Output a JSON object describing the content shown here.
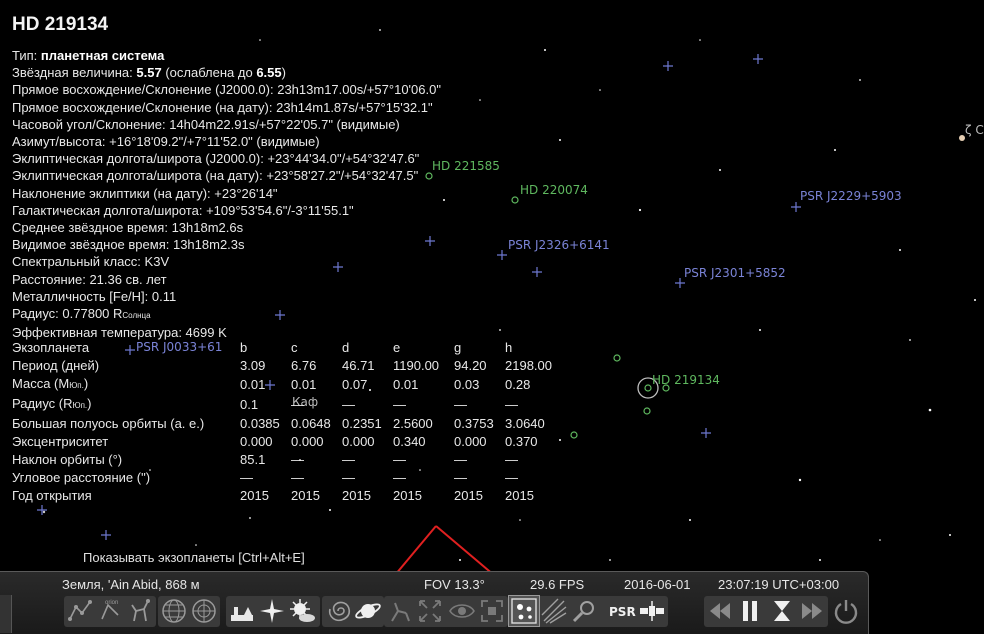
{
  "object": {
    "title": "HD 219134",
    "info_lines": [
      {
        "label": "Тип: ",
        "value": "планетная система",
        "bold": true
      },
      {
        "label": "Звёздная величина: ",
        "value": "5.57",
        "bold": true,
        "suffix": " (ослаблена до ",
        "value2": "6.55",
        "suffix2": ")"
      },
      {
        "label": "Прямое восхождение/Склонение (J2000.0): ",
        "value": "23h13m17.00s/+57°10'06.0\""
      },
      {
        "label": "Прямое восхождение/Склонение (на дату): ",
        "value": "23h14m1.87s/+57°15'32.1\""
      },
      {
        "label": "Часовой угол/Склонение: ",
        "value": "14h04m22.91s/+57°22'05.7\" (видимые)"
      },
      {
        "label": "Азимут/высота: ",
        "value": "+16°18'09.2\"/+7°11'52.0\" (видимые)"
      },
      {
        "label": "Эклиптическая долгота/широта (J2000.0): ",
        "value": "+23°44'34.0\"/+54°32'47.6\""
      },
      {
        "label": "Эклиптическая долгота/широта (на дату): ",
        "value": "+23°58'27.2\"/+54°32'47.5\""
      },
      {
        "label": "Наклонение эклиптики (на дату): ",
        "value": "+23°26'14\""
      },
      {
        "label": "Галактическая долгота/широта: ",
        "value": "+109°53'54.6\"/-3°11'55.1\""
      },
      {
        "label": "Среднее звёздное время: ",
        "value": "13h18m2.6s"
      },
      {
        "label": "Видимое звёздное время: ",
        "value": "13h18m2.3s"
      },
      {
        "label": "Спектральный класс: ",
        "value": "K3V"
      },
      {
        "label": "Расстояние: ",
        "value": "21.36 св. лет"
      },
      {
        "label": "Металличность [Fe/H]: ",
        "value": "0.11"
      },
      {
        "label": "Радиус: ",
        "value": "0.77800 R",
        "sub": "Солнца"
      },
      {
        "label": "Эффективная температура: ",
        "value": "4699 K"
      }
    ]
  },
  "exoplanets": {
    "columns": [
      "Экзопланета",
      "b",
      "c",
      "d",
      "e",
      "g",
      "h"
    ],
    "rows": [
      {
        "label": "Период (дней)",
        "values": [
          "3.09",
          "6.76",
          "46.71",
          "1190.00",
          "94.20",
          "2198.00"
        ]
      },
      {
        "label": "Масса (M",
        "sub": "Юп.",
        "label_end": ")",
        "values": [
          "0.01",
          "0.01",
          "0.07",
          "0.01",
          "0.03",
          "0.28"
        ]
      },
      {
        "label": "Радиус (R",
        "sub": "Юп.",
        "label_end": ")",
        "values": [
          "0.1",
          "—",
          "—",
          "—",
          "—",
          "—"
        ]
      },
      {
        "label": "Большая полуось орбиты (а. е.)",
        "values": [
          "0.0385",
          "0.0648",
          "0.2351",
          "2.5600",
          "0.3753",
          "3.0640"
        ]
      },
      {
        "label": "Эксцентриситет",
        "values": [
          "0.000",
          "0.000",
          "0.000",
          "0.340",
          "0.000",
          "0.370"
        ]
      },
      {
        "label": "Наклон орбиты (°)",
        "values": [
          "85.1",
          "—",
          "—",
          "—",
          "—",
          "—"
        ]
      },
      {
        "label": "Угловое расстояние (\")",
        "values": [
          "—",
          "—",
          "—",
          "—",
          "—",
          "—"
        ]
      },
      {
        "label": "Год открытия",
        "values": [
          "2015",
          "2015",
          "2015",
          "2015",
          "2015",
          "2015"
        ]
      }
    ]
  },
  "sky_labels": {
    "psr_j0033": "PSR J0033+61",
    "psr_j2326": "PSR J2326+6141",
    "psr_j2301": "PSR J2301+5852",
    "psr_j2229": "PSR J2229+5903",
    "hd_220074": "HD 220074",
    "hd_221585": "HD 221585",
    "hd_219134": "HD 219134",
    "kaf": "Каф",
    "zeta": "ζ C"
  },
  "tooltip": "Показывать экзопланеты  [Ctrl+Alt+E]",
  "status": {
    "location": "Земля, 'Ain Abid, 868 м",
    "fov": "FOV 13.3°",
    "fps": "29.6 FPS",
    "date": "2016-06-01",
    "time": "23:07:19 UTC+03:00"
  },
  "toolbar": {
    "psr_label": "PSR",
    "constellation_art_label": "orion"
  },
  "colors": {
    "psr": "#7a83d6",
    "hd": "#5fb85f",
    "arrow": "#e02020"
  }
}
